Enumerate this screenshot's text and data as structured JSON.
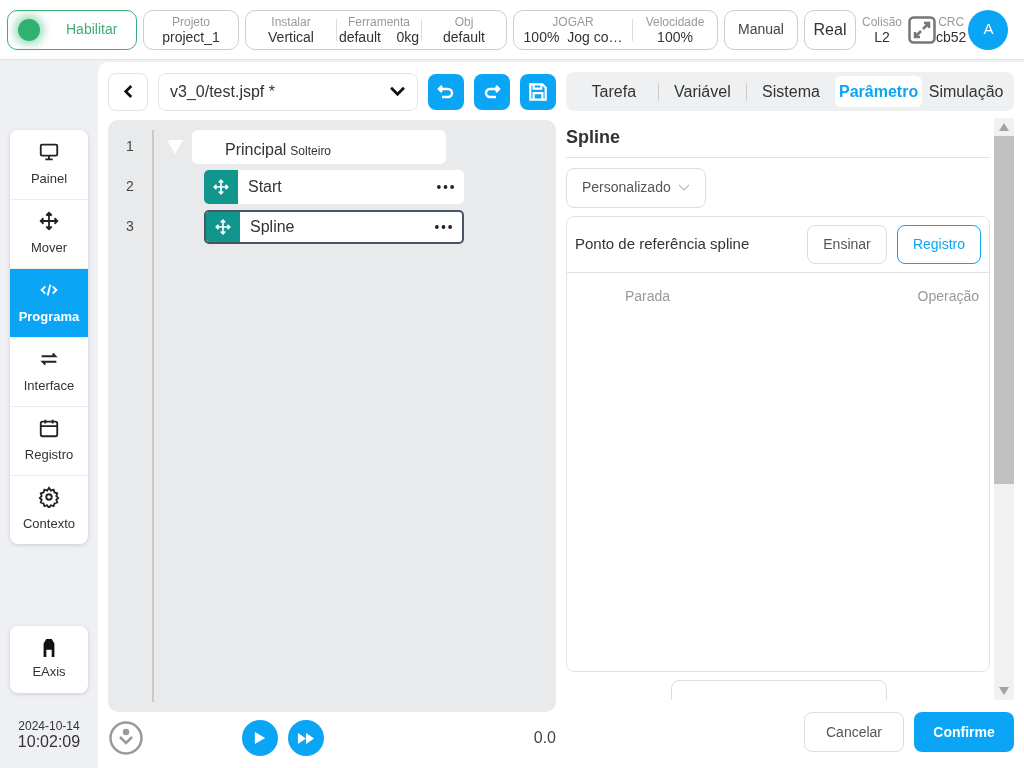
{
  "status_bar": {
    "enable": {
      "label": "Habilitar",
      "on": true
    },
    "groups": [
      {
        "items": [
          {
            "label": "Projeto",
            "value": "project_1"
          }
        ]
      },
      {
        "items": [
          {
            "label": "Instalar",
            "value": "Vertical"
          },
          {
            "label": "Ferramenta",
            "value": "default    0kg"
          },
          {
            "label": "Obj",
            "value": "default"
          }
        ]
      },
      {
        "items": [
          {
            "label": "JOGAR",
            "value": "100%  Jog co…"
          },
          {
            "label": "Velocidade",
            "value": "100%"
          }
        ]
      }
    ],
    "mode_buttons": [
      "Manual",
      "Real"
    ],
    "collision": {
      "label": "Colisão",
      "value": "L2"
    },
    "crc": {
      "label": "CRC",
      "value": "cb52"
    },
    "avatar": "A"
  },
  "sidebar": {
    "items": [
      {
        "label": "Painel",
        "selected": false
      },
      {
        "label": "Mover",
        "selected": false
      },
      {
        "label": "Programa",
        "selected": true
      },
      {
        "label": "Interface",
        "selected": false
      },
      {
        "label": "Registro",
        "selected": false
      },
      {
        "label": "Contexto",
        "selected": false
      }
    ],
    "extra": "EAxis",
    "date": "2024-10-14",
    "time": "10:02:09"
  },
  "editor": {
    "file": "v3_0/test.jspf *",
    "tree": [
      {
        "line": "1",
        "label": "Principal",
        "sublabel": "Solteiro",
        "expanded": true,
        "children": [
          {
            "line": "2",
            "label": "Start",
            "selected": false
          },
          {
            "line": "3",
            "label": "Spline",
            "selected": true
          }
        ]
      }
    ],
    "progress": "0.0"
  },
  "tabs": [
    {
      "label": "Tarefa",
      "selected": false
    },
    {
      "label": "Variável",
      "selected": false
    },
    {
      "label": "Sistema",
      "selected": false
    },
    {
      "label": "Parâmetro",
      "selected": true
    },
    {
      "label": "Simulação",
      "selected": false
    }
  ],
  "panel": {
    "title": "Spline",
    "mode": "Personalizado",
    "waypoints": {
      "label": "Ponto de referência spline",
      "buttons": [
        {
          "label": "Ensinar",
          "kind": "default"
        },
        {
          "label": "Registro",
          "kind": "outline"
        }
      ],
      "columns": [
        "Parada",
        "Operação"
      ]
    }
  },
  "footer_buttons": [
    {
      "label": "Cancelar",
      "kind": "default"
    },
    {
      "label": "Confirme",
      "kind": "primary"
    }
  ]
}
